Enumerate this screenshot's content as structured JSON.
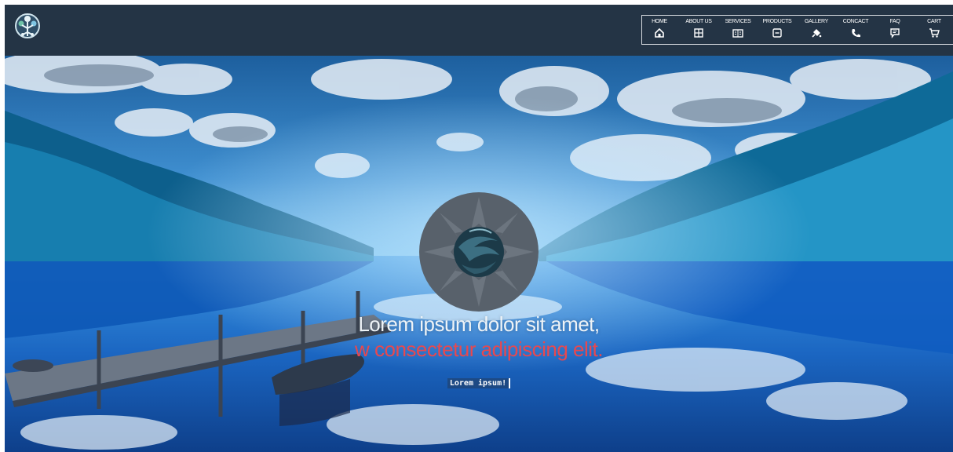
{
  "header": {
    "logo": {
      "icon": "tree-globe-logo-icon"
    },
    "nav": [
      {
        "label": "HOME",
        "icon": "home-icon"
      },
      {
        "label": "ABOUT US",
        "icon": "about-icon"
      },
      {
        "label": "SERVICES",
        "icon": "services-book-icon"
      },
      {
        "label": "PRODUCTS",
        "icon": "products-box-icon"
      },
      {
        "label": "GALLERY",
        "icon": "gallery-paint-icon"
      },
      {
        "label": "CONCACT",
        "icon": "contact-phone-icon"
      },
      {
        "label": "FAQ",
        "icon": "faq-chat-icon"
      },
      {
        "label": "CART",
        "icon": "cart-icon"
      }
    ]
  },
  "hero": {
    "background": {
      "icon": "lake-reflection-background-image"
    },
    "emblem": {
      "icon": "swirl-globe-emblem-icon"
    },
    "headline_line1": "Lorem ipsum dolor sit amet,",
    "headline_line2": "w consectetur adipiscing elit.",
    "cta_label": "Lorem ipsum!"
  },
  "colors": {
    "header_bg": "#243445",
    "accent_red": "#e8484f",
    "text_light": "#eef3f7"
  }
}
